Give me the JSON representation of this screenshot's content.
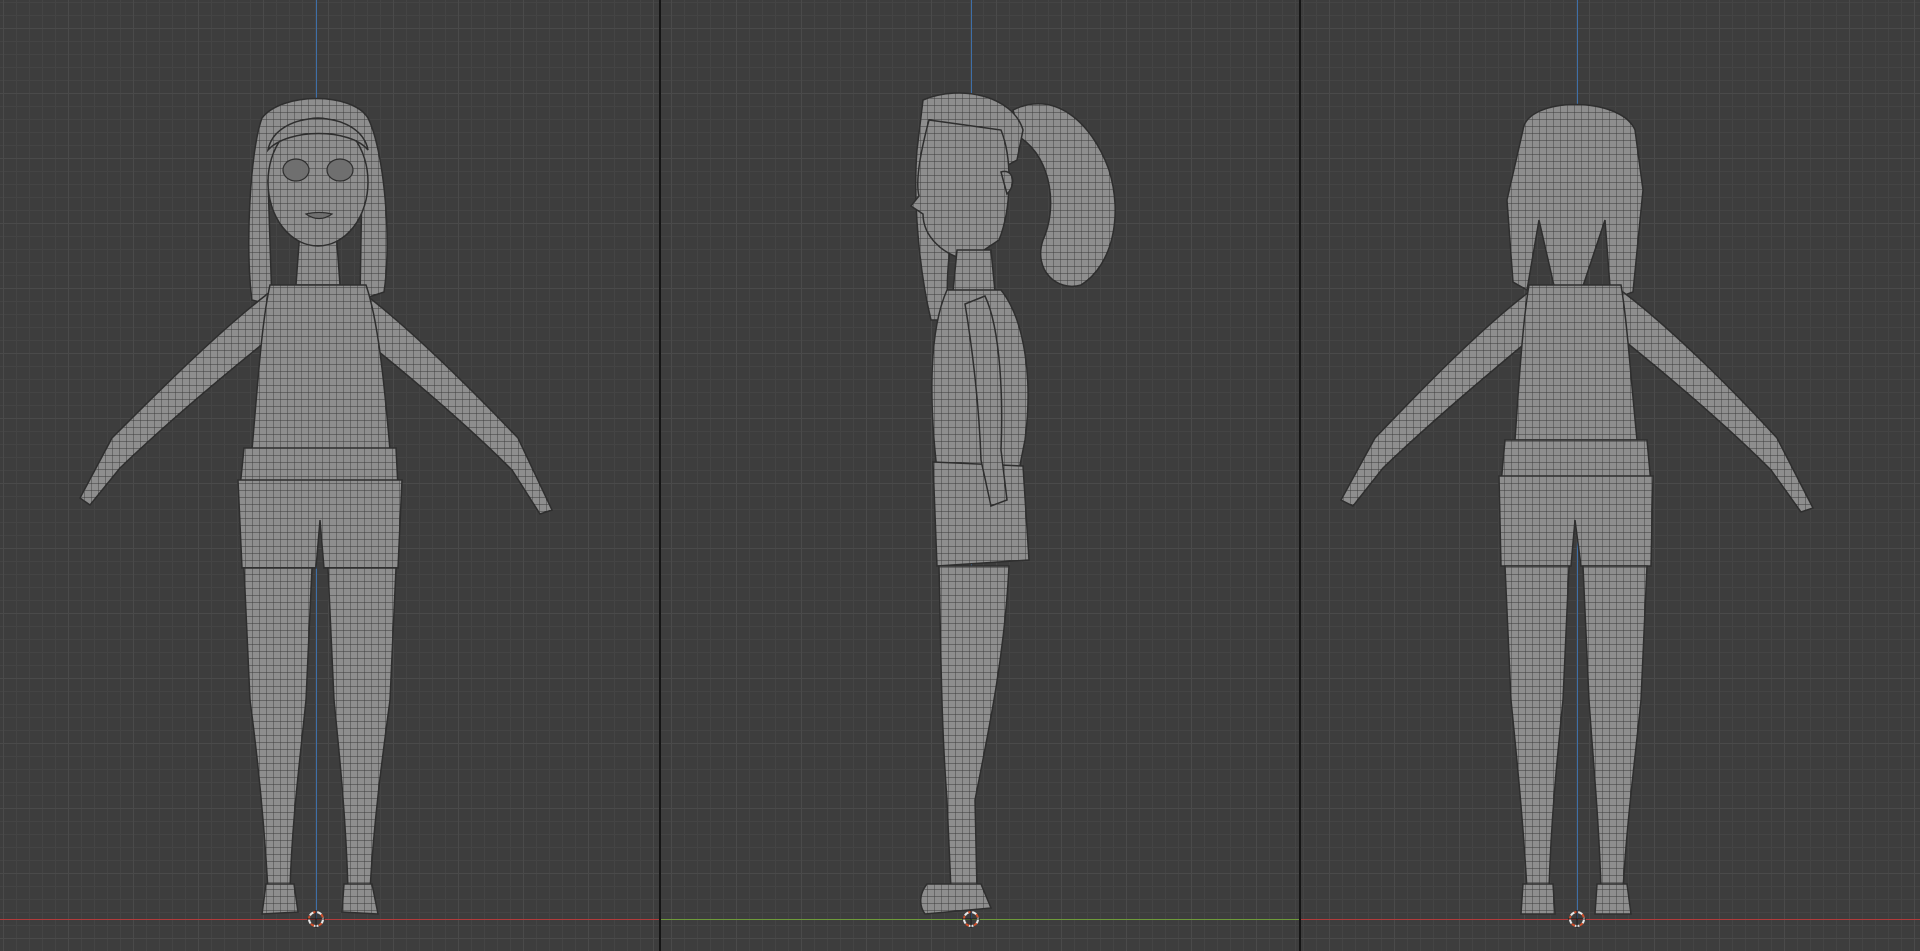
{
  "app": {
    "type": "3d-viewport-layout",
    "views": [
      "front",
      "side",
      "back"
    ]
  },
  "colors": {
    "background": "#3d3d3d",
    "grid_major": "#4a4a4a",
    "grid_minor": "#444444",
    "divider": "#151515",
    "x_axis": "#b33b3b",
    "y_axis": "#6e9a3a",
    "z_axis": "#3e6fa8",
    "mesh_fill": "#8c8c8c",
    "mesh_wire": "#3a3a3a",
    "cursor_ring": "#e8e8e8",
    "cursor_accent": "#d2502b"
  },
  "icons": {
    "cursor": "3d-cursor-icon"
  }
}
